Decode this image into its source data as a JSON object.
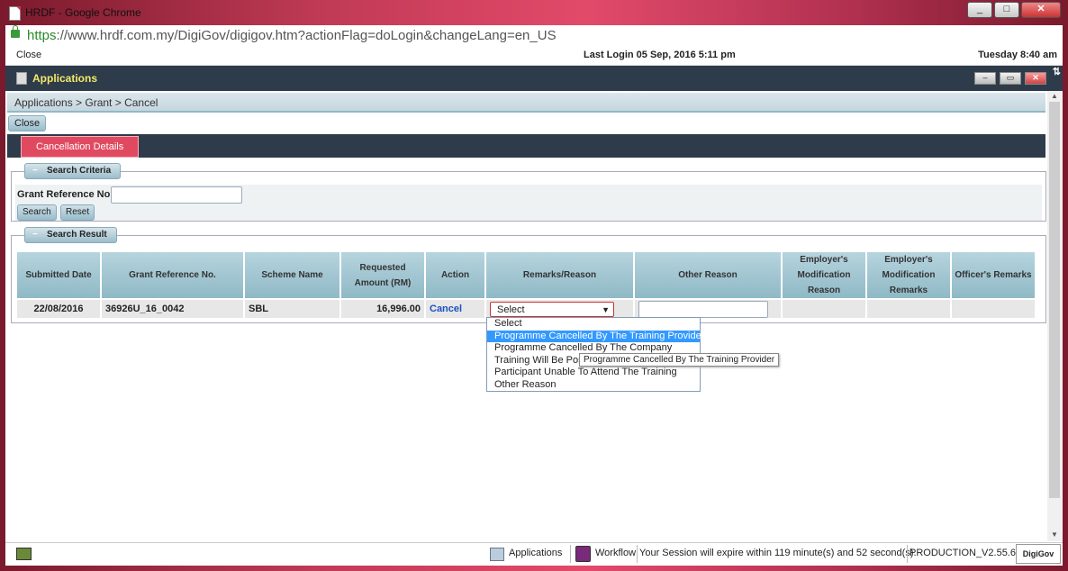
{
  "window": {
    "title": "HRDF - Google Chrome",
    "url_scheme": "https",
    "url_rest": "://www.hrdf.com.my/DigiGov/digigov.htm?actionFlag=doLogin&changeLang=en_US"
  },
  "topline": {
    "close": "Close",
    "last_login": "Last Login 05 Sep, 2016 5:11 pm",
    "time": "Tuesday 8:40 am"
  },
  "appbar": {
    "title": "Applications"
  },
  "breadcrumb": "Applications  > Grant  > Cancel",
  "close_button": "Close",
  "tab": "Cancellation Details",
  "search": {
    "legend": "Search Criteria",
    "grant_ref_label": "Grant Reference No.",
    "grant_ref_value": "",
    "search_button": "Search",
    "reset_button": "Reset"
  },
  "result": {
    "legend": "Search Result",
    "headers": [
      "Submitted Date",
      "Grant Reference No.",
      "Scheme Name",
      "Requested Amount (RM)",
      "Action",
      "Remarks/Reason",
      "Other Reason",
      "Employer's Modification Reason",
      "Employer's Modification Remarks",
      "Officer's Remarks"
    ],
    "row": {
      "submitted_date": "22/08/2016",
      "grant_ref": "36926U_16_0042",
      "scheme": "SBL",
      "amount": "16,996.00",
      "action": "Cancel",
      "remarks_selected": "Select",
      "other_reason": ""
    }
  },
  "dropdown": {
    "options": [
      "Select",
      "Programme Cancelled By The Training Provider",
      "Programme Cancelled By The Company",
      "Training Will Be Postponed",
      "Participant Unable To Attend The Training",
      "Other Reason"
    ],
    "highlighted_index": 1
  },
  "tooltip": "Programme Cancelled By The Training Provider",
  "statusbar": {
    "applications": "Applications",
    "workflow": "Workflow",
    "session": "Your Session will expire within 119 minute(s) and 52 second(s).",
    "version": "PRODUCTION_V2.55.6",
    "logo": "DigiGov"
  },
  "colors": {
    "accent_tab": "#e04a60",
    "appbar": "#2e3b4a",
    "header_cell": "#8fb9c6",
    "link": "#1a52c0",
    "highlight": "#3399ff"
  }
}
